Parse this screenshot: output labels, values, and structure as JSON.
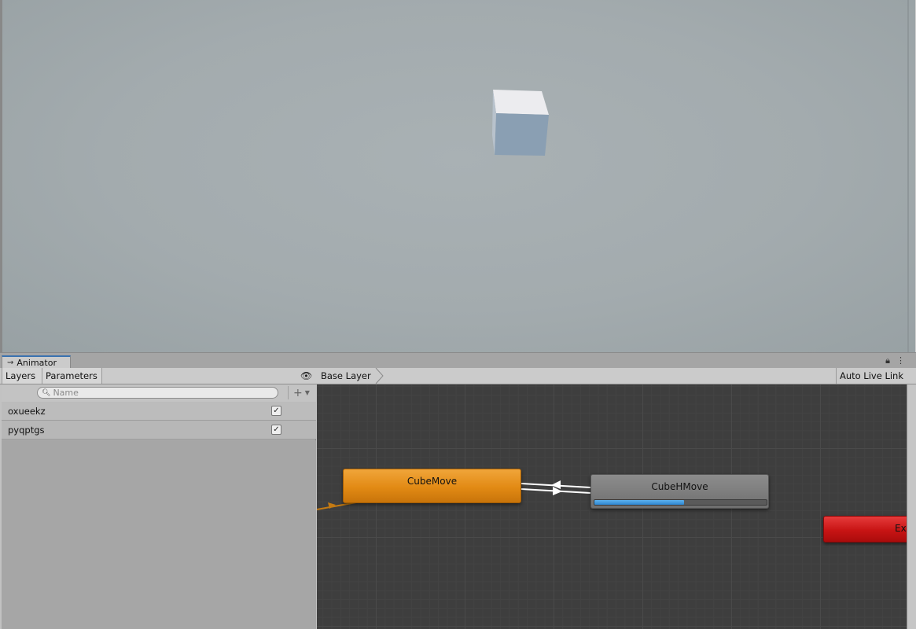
{
  "animator": {
    "tab_label": "Animator",
    "toolbar": {
      "layers_label": "Layers",
      "parameters_label": "Parameters",
      "breadcrumb": "Base Layer",
      "live_link_label": "Auto Live Link"
    },
    "parameters": {
      "search_placeholder": "Name",
      "items": [
        {
          "name": "oxueekz",
          "checked": true
        },
        {
          "name": "pyqptgs",
          "checked": true
        }
      ]
    },
    "graph": {
      "states": {
        "cube_move": "CubeMove",
        "cube_hmove": "CubeHMove",
        "exit": "Exit"
      },
      "cube_hmove_progress": 0.52
    }
  },
  "icons": {
    "animator_tab": "animator-icon",
    "lock": "lock-icon",
    "menu": "kebab-menu-icon",
    "eye": "eye-icon",
    "search": "search-icon",
    "add": "plus-icon"
  },
  "colors": {
    "state_default": "#e28a14",
    "state_normal": "#7e7e7e",
    "state_exit": "#c81414",
    "progress": "#2f86d0",
    "tab_accent": "#3a72b0"
  }
}
